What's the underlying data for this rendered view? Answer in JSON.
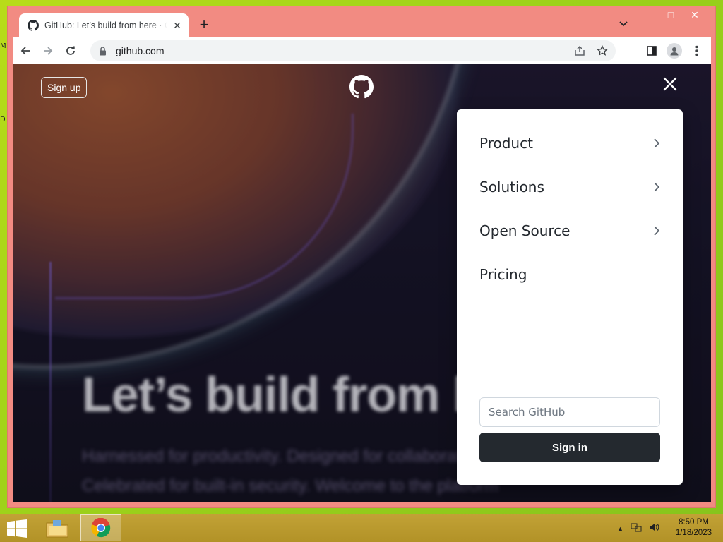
{
  "desktop": {
    "edge_letters": [
      "M",
      "D"
    ]
  },
  "browser": {
    "tab": {
      "title": "GitHub: Let’s build from here · GitHub",
      "favicon": "github-icon",
      "close": "✕"
    },
    "new_tab": "+",
    "url": "github.com",
    "window_controls": [
      "–",
      "□",
      "✕"
    ]
  },
  "page": {
    "signup_label": "Sign up",
    "hero_title": "Let’s build from here",
    "hero_subtitle_lines": [
      "Harnessed for productivity. Designed for collaboration.",
      "Celebrated for built-in security. Welcome to the platform"
    ],
    "menu": {
      "items": [
        {
          "label": "Product",
          "has_chevron": true
        },
        {
          "label": "Solutions",
          "has_chevron": true
        },
        {
          "label": "Open Source",
          "has_chevron": true
        },
        {
          "label": "Pricing",
          "has_chevron": false
        }
      ],
      "search_placeholder": "Search GitHub",
      "signin_label": "Sign in"
    }
  },
  "taskbar": {
    "time": "8:50 PM",
    "date": "1/18/2023",
    "tray_expand": "▲"
  },
  "colors": {
    "menu_button": "#24292f",
    "titlebar": "#f28b82",
    "taskbar": "#b99a2e"
  }
}
